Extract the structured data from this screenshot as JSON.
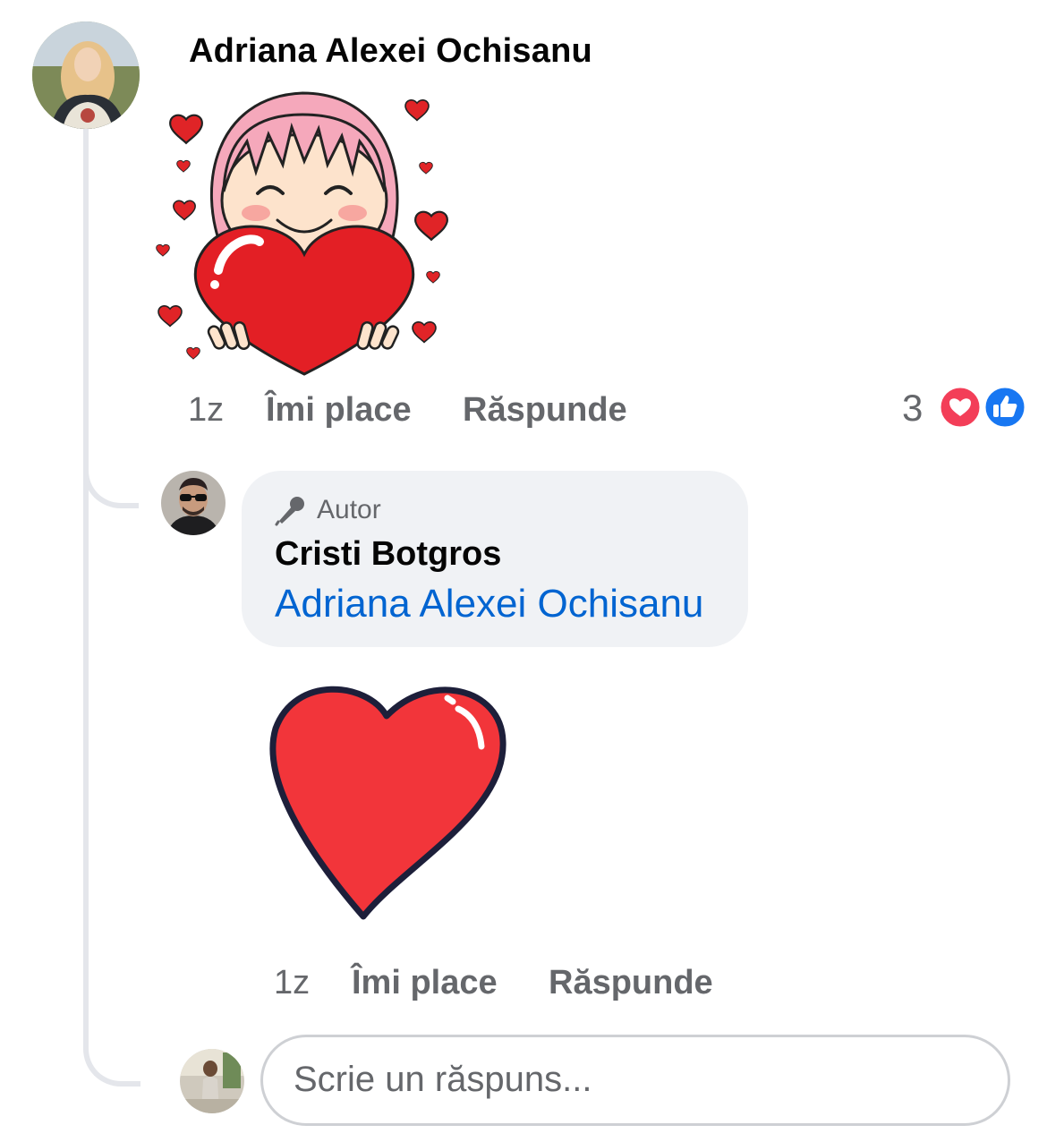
{
  "comment": {
    "author": "Adriana Alexei Ochisanu",
    "time": "1z",
    "like_label": "Îmi place",
    "reply_label": "Răspunde",
    "reaction_count": "3",
    "reactions": [
      "love-reaction",
      "like-reaction"
    ],
    "sticker": "girl-holding-heart-sticker"
  },
  "reply": {
    "badge": "Autor",
    "badge_icon": "microphone-icon",
    "author": "Cristi Botgros",
    "mention": "Adriana Alexei Ochisanu",
    "time": "1z",
    "like_label": "Îmi place",
    "reply_label": "Răspunde",
    "sticker": "red-heart-sticker"
  },
  "composer": {
    "placeholder": "Scrie un răspuns..."
  },
  "colors": {
    "link": "#0064d1",
    "secondary_text": "#65676b",
    "bubble": "#f0f2f5",
    "heart": "#f2353a",
    "like_blue": "#1877f2"
  }
}
